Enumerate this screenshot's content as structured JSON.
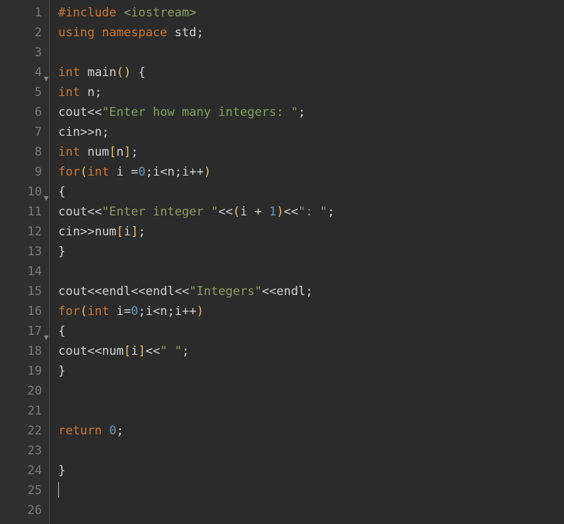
{
  "editor": {
    "line_count": 26,
    "fold_markers": [
      4,
      10,
      17
    ],
    "cursor_line": 25,
    "lines": [
      {
        "n": 1,
        "tokens": [
          {
            "t": "#include ",
            "c": "tok-pre"
          },
          {
            "t": "<iostream>",
            "c": "tok-inc"
          }
        ]
      },
      {
        "n": 2,
        "tokens": [
          {
            "t": "using ",
            "c": "tok-kw"
          },
          {
            "t": "namespace ",
            "c": "tok-kw"
          },
          {
            "t": "std",
            "c": "tok-id"
          },
          {
            "t": ";",
            "c": "tok-punct"
          }
        ]
      },
      {
        "n": 3,
        "tokens": []
      },
      {
        "n": 4,
        "tokens": [
          {
            "t": "int ",
            "c": "tok-type"
          },
          {
            "t": "main",
            "c": "tok-func"
          },
          {
            "t": "()",
            "c": "tok-paren"
          },
          {
            "t": " ",
            "c": "tok-id"
          },
          {
            "t": "{",
            "c": "tok-brace"
          }
        ]
      },
      {
        "n": 5,
        "tokens": [
          {
            "t": "int ",
            "c": "tok-type"
          },
          {
            "t": "n",
            "c": "tok-id"
          },
          {
            "t": ";",
            "c": "tok-punct"
          }
        ]
      },
      {
        "n": 6,
        "tokens": [
          {
            "t": "cout",
            "c": "tok-id"
          },
          {
            "t": "<<",
            "c": "tok-op"
          },
          {
            "t": "\"Enter how many integers: \"",
            "c": "tok-str"
          },
          {
            "t": ";",
            "c": "tok-punct"
          }
        ]
      },
      {
        "n": 7,
        "tokens": [
          {
            "t": "cin",
            "c": "tok-id"
          },
          {
            "t": ">>",
            "c": "tok-op"
          },
          {
            "t": "n",
            "c": "tok-id"
          },
          {
            "t": ";",
            "c": "tok-punct"
          }
        ]
      },
      {
        "n": 8,
        "tokens": [
          {
            "t": "int ",
            "c": "tok-type"
          },
          {
            "t": "num",
            "c": "tok-id"
          },
          {
            "t": "[",
            "c": "tok-paren"
          },
          {
            "t": "n",
            "c": "tok-id"
          },
          {
            "t": "]",
            "c": "tok-paren"
          },
          {
            "t": ";",
            "c": "tok-punct"
          }
        ]
      },
      {
        "n": 9,
        "tokens": [
          {
            "t": "for",
            "c": "tok-kw"
          },
          {
            "t": "(",
            "c": "tok-paren"
          },
          {
            "t": "int ",
            "c": "tok-type"
          },
          {
            "t": "i ",
            "c": "tok-id"
          },
          {
            "t": "=",
            "c": "tok-op"
          },
          {
            "t": "0",
            "c": "tok-num"
          },
          {
            "t": ";",
            "c": "tok-punct"
          },
          {
            "t": "i",
            "c": "tok-id"
          },
          {
            "t": "<",
            "c": "tok-op"
          },
          {
            "t": "n",
            "c": "tok-id"
          },
          {
            "t": ";",
            "c": "tok-punct"
          },
          {
            "t": "i",
            "c": "tok-id"
          },
          {
            "t": "++",
            "c": "tok-op"
          },
          {
            "t": ")",
            "c": "tok-paren"
          }
        ]
      },
      {
        "n": 10,
        "tokens": [
          {
            "t": "{",
            "c": "tok-brace"
          }
        ]
      },
      {
        "n": 11,
        "tokens": [
          {
            "t": "cout",
            "c": "tok-id"
          },
          {
            "t": "<<",
            "c": "tok-op"
          },
          {
            "t": "\"Enter integer \"",
            "c": "tok-str"
          },
          {
            "t": "<<",
            "c": "tok-op"
          },
          {
            "t": "(",
            "c": "tok-paren"
          },
          {
            "t": "i ",
            "c": "tok-id"
          },
          {
            "t": "+ ",
            "c": "tok-op"
          },
          {
            "t": "1",
            "c": "tok-num"
          },
          {
            "t": ")",
            "c": "tok-paren"
          },
          {
            "t": "<<",
            "c": "tok-op"
          },
          {
            "t": "\": \"",
            "c": "tok-str"
          },
          {
            "t": ";",
            "c": "tok-punct"
          }
        ]
      },
      {
        "n": 12,
        "tokens": [
          {
            "t": "cin",
            "c": "tok-id"
          },
          {
            "t": ">>",
            "c": "tok-op"
          },
          {
            "t": "num",
            "c": "tok-id"
          },
          {
            "t": "[",
            "c": "tok-paren"
          },
          {
            "t": "i",
            "c": "tok-id"
          },
          {
            "t": "]",
            "c": "tok-paren"
          },
          {
            "t": ";",
            "c": "tok-punct"
          }
        ]
      },
      {
        "n": 13,
        "tokens": [
          {
            "t": "}",
            "c": "tok-brace"
          }
        ]
      },
      {
        "n": 14,
        "tokens": []
      },
      {
        "n": 15,
        "tokens": [
          {
            "t": "cout",
            "c": "tok-id"
          },
          {
            "t": "<<",
            "c": "tok-op"
          },
          {
            "t": "endl",
            "c": "tok-id"
          },
          {
            "t": "<<",
            "c": "tok-op"
          },
          {
            "t": "endl",
            "c": "tok-id"
          },
          {
            "t": "<<",
            "c": "tok-op"
          },
          {
            "t": "\"Integers\"",
            "c": "tok-str"
          },
          {
            "t": "<<",
            "c": "tok-op"
          },
          {
            "t": "endl",
            "c": "tok-id"
          },
          {
            "t": ";",
            "c": "tok-punct"
          }
        ]
      },
      {
        "n": 16,
        "tokens": [
          {
            "t": "for",
            "c": "tok-kw"
          },
          {
            "t": "(",
            "c": "tok-paren"
          },
          {
            "t": "int ",
            "c": "tok-type"
          },
          {
            "t": "i",
            "c": "tok-id"
          },
          {
            "t": "=",
            "c": "tok-op"
          },
          {
            "t": "0",
            "c": "tok-num"
          },
          {
            "t": ";",
            "c": "tok-punct"
          },
          {
            "t": "i",
            "c": "tok-id"
          },
          {
            "t": "<",
            "c": "tok-op"
          },
          {
            "t": "n",
            "c": "tok-id"
          },
          {
            "t": ";",
            "c": "tok-punct"
          },
          {
            "t": "i",
            "c": "tok-id"
          },
          {
            "t": "++",
            "c": "tok-op"
          },
          {
            "t": ")",
            "c": "tok-paren"
          }
        ]
      },
      {
        "n": 17,
        "tokens": [
          {
            "t": "{",
            "c": "tok-brace"
          }
        ]
      },
      {
        "n": 18,
        "tokens": [
          {
            "t": "cout",
            "c": "tok-id"
          },
          {
            "t": "<<",
            "c": "tok-op"
          },
          {
            "t": "num",
            "c": "tok-id"
          },
          {
            "t": "[",
            "c": "tok-paren"
          },
          {
            "t": "i",
            "c": "tok-id"
          },
          {
            "t": "]",
            "c": "tok-paren"
          },
          {
            "t": "<<",
            "c": "tok-op"
          },
          {
            "t": "\" \"",
            "c": "tok-str"
          },
          {
            "t": ";",
            "c": "tok-punct"
          }
        ]
      },
      {
        "n": 19,
        "tokens": [
          {
            "t": "}",
            "c": "tok-brace"
          }
        ]
      },
      {
        "n": 20,
        "tokens": []
      },
      {
        "n": 21,
        "tokens": []
      },
      {
        "n": 22,
        "tokens": [
          {
            "t": "return ",
            "c": "tok-kw"
          },
          {
            "t": "0",
            "c": "tok-num"
          },
          {
            "t": ";",
            "c": "tok-punct"
          }
        ]
      },
      {
        "n": 23,
        "tokens": []
      },
      {
        "n": 24,
        "tokens": [
          {
            "t": "}",
            "c": "tok-brace"
          }
        ]
      },
      {
        "n": 25,
        "tokens": []
      },
      {
        "n": 26,
        "tokens": []
      }
    ]
  }
}
